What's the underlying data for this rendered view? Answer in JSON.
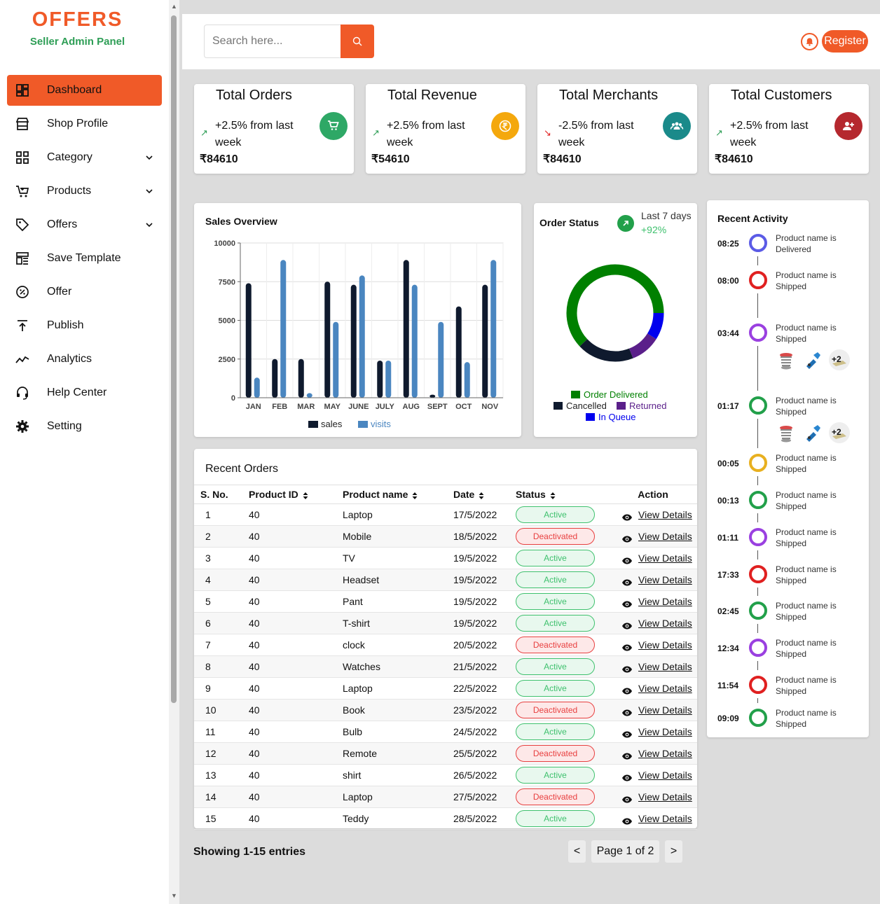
{
  "brand": {
    "name": "OFFERS",
    "subtitle": "Seller Admin Panel",
    "accent": "#f05a28",
    "green": "#2e9e56"
  },
  "nav": [
    {
      "label": "Dashboard",
      "icon": "dashboard-icon",
      "active": true
    },
    {
      "label": "Shop Profile",
      "icon": "shop-icon"
    },
    {
      "label": "Category",
      "icon": "category-icon",
      "dropdown": true
    },
    {
      "label": "Products",
      "icon": "cart-icon",
      "dropdown": true
    },
    {
      "label": "Offers",
      "icon": "tag-icon",
      "dropdown": true
    },
    {
      "label": "Save Template",
      "icon": "template-icon"
    },
    {
      "label": "Offer",
      "icon": "discount-icon"
    },
    {
      "label": "Publish",
      "icon": "publish-icon"
    },
    {
      "label": "Analytics",
      "icon": "analytics-icon"
    },
    {
      "label": "Help Center",
      "icon": "headset-icon"
    },
    {
      "label": "Setting",
      "icon": "gear-icon"
    }
  ],
  "header": {
    "search_placeholder": "Search here...",
    "register_label": "Register"
  },
  "stats": [
    {
      "title": "Total Orders",
      "trend": "up",
      "change": "+2.5% from last week",
      "value": "₹84610",
      "icon": "cart-icon",
      "color": "#2ea866"
    },
    {
      "title": "Total Revenue",
      "trend": "up",
      "change": "+2.5% from last week",
      "value": "₹54610",
      "icon": "rupee-icon",
      "color": "#f4a80d"
    },
    {
      "title": "Total Merchants",
      "trend": "down",
      "change": "-2.5% from last week",
      "value": "₹84610",
      "icon": "users-icon",
      "color": "#1a8a8a"
    },
    {
      "title": "Total Customers",
      "trend": "up",
      "change": "+2.5% from last week",
      "value": "₹84610",
      "icon": "add-user-icon",
      "color": "#b5282e"
    }
  ],
  "sales": {
    "title": "Sales Overview",
    "chart_data": {
      "type": "bar",
      "categories": [
        "JAN",
        "FEB",
        "MAR",
        "MAY",
        "JUNE",
        "JULY",
        "AUG",
        "SEPT",
        "OCT",
        "NOV"
      ],
      "series": [
        {
          "name": "sales",
          "color": "#0f1a2e",
          "values": [
            7400,
            2500,
            2500,
            7500,
            7300,
            2400,
            8900,
            200,
            5900,
            7300
          ]
        },
        {
          "name": "visits",
          "color": "#4a86c0",
          "values": [
            1300,
            8900,
            300,
            4900,
            7900,
            2400,
            7300,
            4900,
            2300,
            8900
          ]
        }
      ],
      "yticks": [
        "10000",
        "7500",
        "5000",
        "2500",
        "0"
      ],
      "ylim": [
        0,
        10000
      ]
    }
  },
  "order_status": {
    "title": "Order Status",
    "period": "Last 7 days",
    "change": "+92%",
    "chart_data": {
      "type": "pie",
      "slices": [
        {
          "label": "Order Delivered",
          "value": 62,
          "color": "#008000"
        },
        {
          "label": "Cancelled",
          "value": 19,
          "color": "#0f1a2e"
        },
        {
          "label": "Returned",
          "value": 10,
          "color": "#5a1f8a"
        },
        {
          "label": "In Queue",
          "value": 9,
          "color": "#0000ee"
        }
      ]
    }
  },
  "activity": {
    "title": "Recent Activity",
    "items": [
      {
        "time": "08:25",
        "text": "Product name is Delivered",
        "color": "#5b5be6"
      },
      {
        "time": "08:00",
        "text": "Product name is Shipped",
        "color": "#e02020"
      },
      {
        "time": "03:44",
        "text": "Product name is Shipped",
        "color": "#9a40e0",
        "images": true,
        "more": "+2"
      },
      {
        "time": "01:17",
        "text": "Product name is Shipped",
        "color": "#22a04a",
        "images": true,
        "more": "+2"
      },
      {
        "time": "00:05",
        "text": "Product name is Shipped",
        "color": "#e8b020"
      },
      {
        "time": "00:13",
        "text": "Product name is Shipped",
        "color": "#22a04a"
      },
      {
        "time": "01:11",
        "text": "Product name is Shipped",
        "color": "#9a40e0"
      },
      {
        "time": "17:33",
        "text": "Product name is Shipped",
        "color": "#e02020"
      },
      {
        "time": "02:45",
        "text": "Product name is Shipped",
        "color": "#22a04a"
      },
      {
        "time": "12:34",
        "text": "Product name is Shipped",
        "color": "#9a40e0"
      },
      {
        "time": "11:54",
        "text": "Product name is Shipped",
        "color": "#e02020"
      },
      {
        "time": "09:09",
        "text": "Product name is Shipped",
        "color": "#22a04a"
      }
    ]
  },
  "orders": {
    "title": "Recent Orders",
    "columns": [
      "S. No.",
      "Product ID",
      "Product name",
      "Date",
      "Status",
      "Action"
    ],
    "action_label": "View Details",
    "rows": [
      {
        "no": "1",
        "id": "40",
        "name": "Laptop",
        "date": "17/5/2022",
        "status": "Active"
      },
      {
        "no": "2",
        "id": "40",
        "name": "Mobile",
        "date": "18/5/2022",
        "status": "Deactivated"
      },
      {
        "no": "3",
        "id": "40",
        "name": "TV",
        "date": "19/5/2022",
        "status": "Active"
      },
      {
        "no": "4",
        "id": "40",
        "name": "Headset",
        "date": "19/5/2022",
        "status": "Active"
      },
      {
        "no": "5",
        "id": "40",
        "name": "Pant",
        "date": "19/5/2022",
        "status": "Active"
      },
      {
        "no": "6",
        "id": "40",
        "name": "T-shirt",
        "date": "19/5/2022",
        "status": "Active"
      },
      {
        "no": "7",
        "id": "40",
        "name": "clock",
        "date": "20/5/2022",
        "status": "Deactivated"
      },
      {
        "no": "8",
        "id": "40",
        "name": "Watches",
        "date": "21/5/2022",
        "status": "Active"
      },
      {
        "no": "9",
        "id": "40",
        "name": "Laptop",
        "date": "22/5/2022",
        "status": "Active"
      },
      {
        "no": "10",
        "id": "40",
        "name": "Book",
        "date": "23/5/2022",
        "status": "Deactivated"
      },
      {
        "no": "11",
        "id": "40",
        "name": "Bulb",
        "date": "24/5/2022",
        "status": "Active"
      },
      {
        "no": "12",
        "id": "40",
        "name": "Remote",
        "date": "25/5/2022",
        "status": "Deactivated"
      },
      {
        "no": "13",
        "id": "40",
        "name": "shirt",
        "date": "26/5/2022",
        "status": "Active"
      },
      {
        "no": "14",
        "id": "40",
        "name": "Laptop",
        "date": "27/5/2022",
        "status": "Deactivated"
      },
      {
        "no": "15",
        "id": "40",
        "name": "Teddy",
        "date": "28/5/2022",
        "status": "Active"
      }
    ]
  },
  "pagination": {
    "showing": "Showing 1-15 entries",
    "prev": "<",
    "page": "Page 1 of 2",
    "next": ">"
  }
}
